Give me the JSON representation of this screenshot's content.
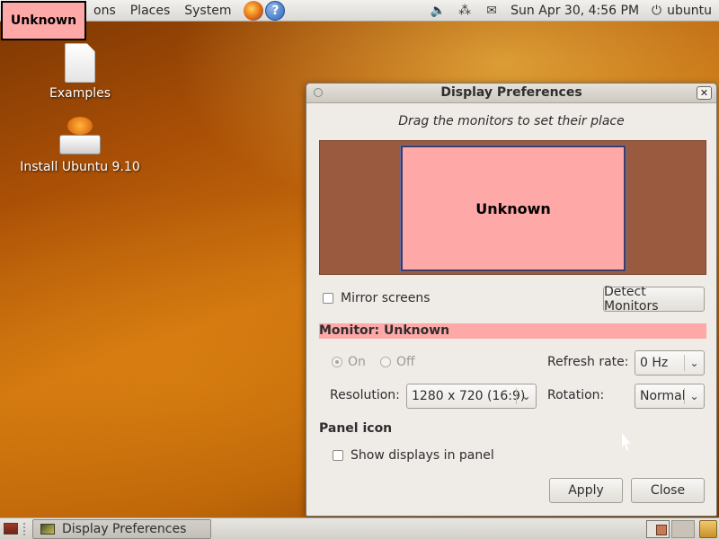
{
  "top_panel": {
    "menus": [
      "ons",
      "Places",
      "System"
    ],
    "datetime": "Sun Apr 30,  4:56 PM",
    "user": "ubuntu",
    "icons": [
      "firefox-icon",
      "help-icon",
      "volume-icon",
      "network-icon",
      "mail-icon",
      "power-icon"
    ]
  },
  "overlay_label": "Unknown",
  "desktop": {
    "icons": [
      {
        "label": "Examples",
        "icon": "folder-documents-icon"
      },
      {
        "label": "Install Ubuntu 9.10",
        "icon": "installer-icon"
      }
    ]
  },
  "dialog": {
    "title": "Display Preferences",
    "instruction": "Drag the monitors to set their place",
    "monitor_box_label": "Unknown",
    "mirror_screens_label": "Mirror screens",
    "mirror_screens_checked": false,
    "detect_button": "Detect Monitors",
    "monitor_header": "Monitor: Unknown",
    "on_label": "On",
    "off_label": "Off",
    "refresh_label": "Refresh rate:",
    "refresh_value": "0 Hz",
    "resolution_label": "Resolution:",
    "resolution_value": "1280 x 720 (16:9)",
    "rotation_label": "Rotation:",
    "rotation_value": "Normal",
    "panel_icon_heading": "Panel icon",
    "show_displays_label": "Show displays in panel",
    "show_displays_checked": false,
    "apply_button": "Apply",
    "close_button": "Close",
    "colors": {
      "monitor_fill": "#ffa8a8",
      "monitor_area": "#9a5a40"
    }
  },
  "bottom_panel": {
    "task_label": "Display Preferences"
  }
}
